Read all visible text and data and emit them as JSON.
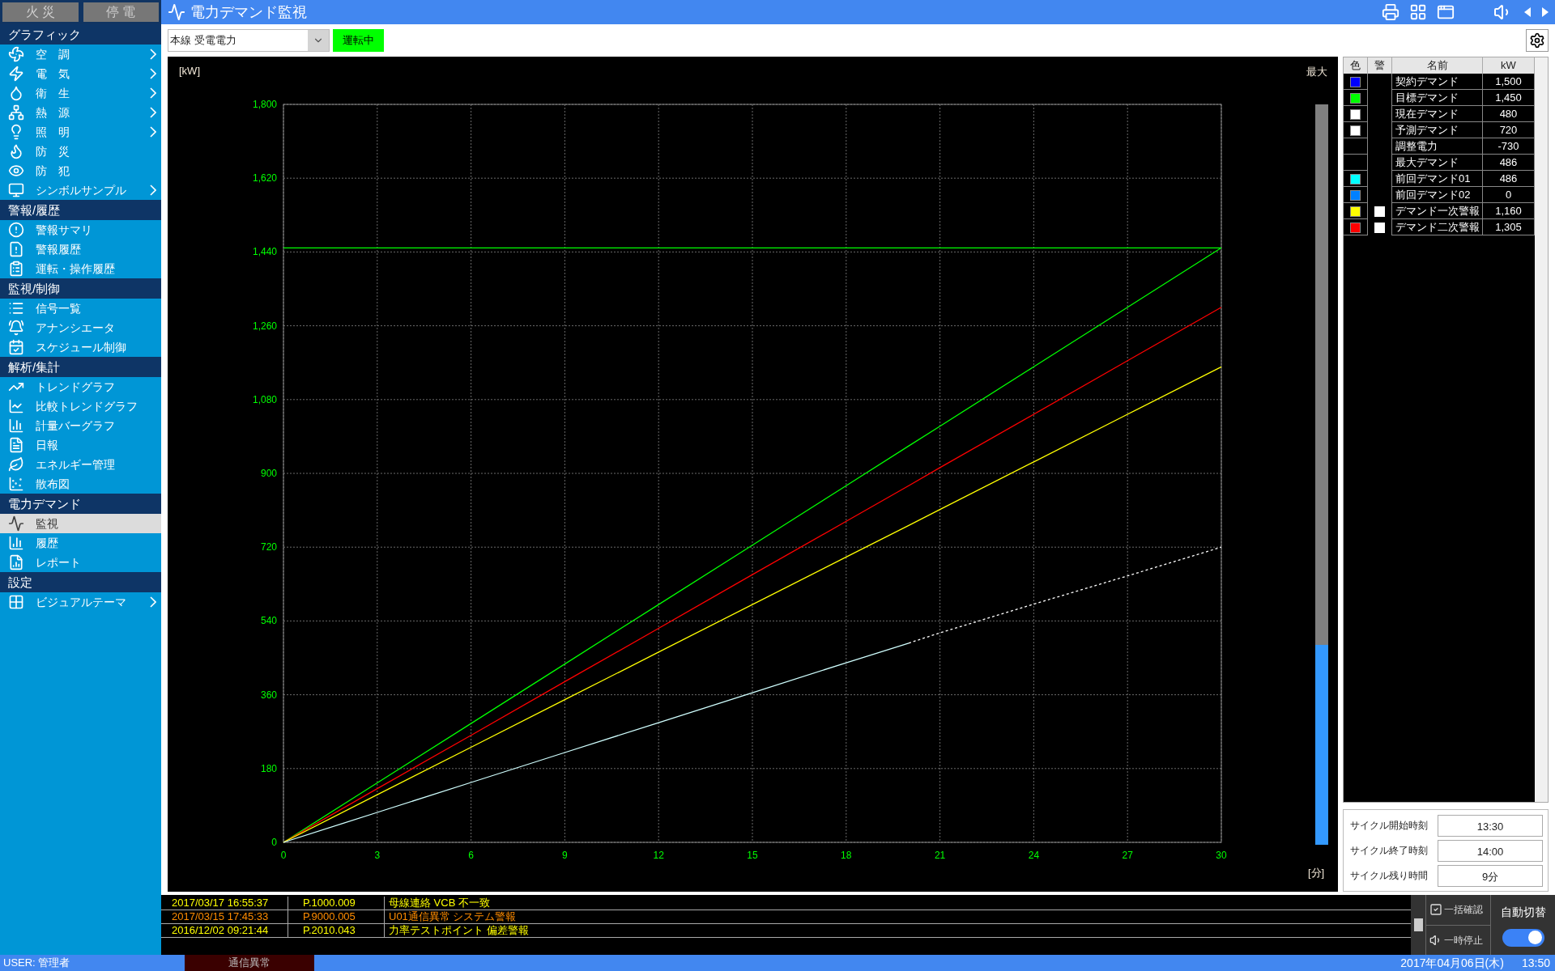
{
  "alarm_buttons": [
    "火 災",
    "停 電"
  ],
  "header": {
    "title": "電力デマンド監視"
  },
  "sidebar": {
    "sections": [
      {
        "title": "グラフィック",
        "items": [
          {
            "label": "空　調",
            "expandable": true,
            "selected": false
          },
          {
            "label": "電　気",
            "expandable": true,
            "selected": false
          },
          {
            "label": "衛　生",
            "expandable": true,
            "selected": false
          },
          {
            "label": "熱　源",
            "expandable": true,
            "selected": false
          },
          {
            "label": "照　明",
            "expandable": true,
            "selected": false
          },
          {
            "label": "防　災",
            "expandable": false,
            "selected": false
          },
          {
            "label": "防　犯",
            "expandable": false,
            "selected": false
          },
          {
            "label": "シンボルサンプル",
            "expandable": true,
            "selected": false
          }
        ]
      },
      {
        "title": "警報/履歴",
        "items": [
          {
            "label": "警報サマリ",
            "expandable": false,
            "selected": false
          },
          {
            "label": "警報履歴",
            "expandable": false,
            "selected": false
          },
          {
            "label": "運転・操作履歴",
            "expandable": false,
            "selected": false
          }
        ]
      },
      {
        "title": "監視/制御",
        "items": [
          {
            "label": "信号一覧",
            "expandable": false,
            "selected": false
          },
          {
            "label": "アナンシエータ",
            "expandable": false,
            "selected": false
          },
          {
            "label": "スケジュール制御",
            "expandable": false,
            "selected": false
          }
        ]
      },
      {
        "title": "解析/集計",
        "items": [
          {
            "label": "トレンドグラフ",
            "expandable": false,
            "selected": false
          },
          {
            "label": "比較トレンドグラフ",
            "expandable": false,
            "selected": false
          },
          {
            "label": "計量バーグラフ",
            "expandable": false,
            "selected": false
          },
          {
            "label": "日報",
            "expandable": false,
            "selected": false
          },
          {
            "label": "エネルギー管理",
            "expandable": false,
            "selected": false
          },
          {
            "label": "散布図",
            "expandable": false,
            "selected": false
          }
        ]
      },
      {
        "title": "電力デマンド",
        "items": [
          {
            "label": "監視",
            "expandable": false,
            "selected": true
          },
          {
            "label": "履歴",
            "expandable": false,
            "selected": false
          },
          {
            "label": "レポート",
            "expandable": false,
            "selected": false
          }
        ]
      },
      {
        "title": "設定",
        "items": [
          {
            "label": "ビジュアルテーマ",
            "expandable": true,
            "selected": false
          }
        ]
      }
    ]
  },
  "toolbar": {
    "source": "本線 受電電力",
    "status": "運転中"
  },
  "chart": {
    "unit_label": "[kW]",
    "x_unit_label": "[分]",
    "gauge_label": "最大",
    "gauge": {
      "level": 0.27
    },
    "chart_data": {
      "type": "line",
      "x": [
        0,
        3,
        6,
        9,
        12,
        15,
        18,
        20,
        21,
        24,
        27,
        30
      ],
      "ylim": [
        0,
        1800
      ],
      "xlim": [
        0,
        30
      ],
      "yticks": [
        {
          "value": 0,
          "label": "0"
        },
        {
          "value": 180,
          "label": "180"
        },
        {
          "value": 360,
          "label": "360"
        },
        {
          "value": 540,
          "label": "540"
        },
        {
          "value": 720,
          "label": "720"
        },
        {
          "value": 900,
          "label": "900"
        },
        {
          "value": 1080,
          "label": "1,080"
        },
        {
          "value": 1260,
          "label": "1,260"
        },
        {
          "value": 1440,
          "label": "1,440"
        },
        {
          "value": 1620,
          "label": "1,620"
        },
        {
          "value": 1800,
          "label": "1,800"
        }
      ],
      "xticks": [
        0,
        3,
        6,
        9,
        12,
        15,
        18,
        21,
        24,
        27,
        30
      ],
      "grid": true,
      "series": [
        {
          "color": "#00ff00",
          "line_style": "solid",
          "values": [
            1450,
            1450,
            1450,
            1450,
            1450,
            1450,
            1450,
            1450,
            1450,
            1450,
            1450,
            1450
          ]
        },
        {
          "color": "#00ff00",
          "line_style": "solid",
          "values": [
            0,
            145,
            290,
            435,
            580,
            725,
            870,
            967,
            1015,
            1160,
            1305,
            1450
          ]
        },
        {
          "color": "#ff0000",
          "line_style": "solid",
          "values": [
            0,
            131,
            261,
            392,
            522,
            653,
            783,
            870,
            914,
            1044,
            1175,
            1305
          ]
        },
        {
          "color": "#ffff00",
          "line_style": "solid",
          "values": [
            0,
            116,
            232,
            348,
            464,
            580,
            696,
            773,
            812,
            928,
            1044,
            1160
          ]
        },
        {
          "color": "#d0ffff",
          "line_style": "solid",
          "values": [
            0,
            73,
            146,
            219,
            292,
            365,
            438,
            486,
            null,
            null,
            null,
            null
          ]
        },
        {
          "color": "#ffffff",
          "line_style": "dashed",
          "values": [
            null,
            null,
            null,
            null,
            null,
            null,
            null,
            486,
            511,
            581,
            650,
            720
          ]
        }
      ]
    }
  },
  "legend": {
    "columns": [
      "色",
      "警",
      "名前",
      "kW"
    ],
    "rows": [
      {
        "color": "#0000ff",
        "alarm": false,
        "name": "契約デマンド",
        "value": "1,500"
      },
      {
        "color": "#00ff00",
        "alarm": false,
        "name": "目標デマンド",
        "value": "1,450"
      },
      {
        "color": "#ffffff",
        "alarm": false,
        "name": "現在デマンド",
        "value": "480"
      },
      {
        "color": "#ffffff",
        "alarm": false,
        "name": "予測デマンド",
        "value": "720"
      },
      {
        "alarm": false,
        "name": "調整電力",
        "value": "-730"
      },
      {
        "alarm": false,
        "name": "最大デマンド",
        "value": "486"
      },
      {
        "color": "#00ffff",
        "alarm": false,
        "name": "前回デマンド01",
        "value": "486"
      },
      {
        "color": "#0080ff",
        "alarm": false,
        "name": "前回デマンド02",
        "value": "0"
      },
      {
        "color": "#ffff00",
        "alarm": true,
        "name": "デマンド一次警報",
        "value": "1,160"
      },
      {
        "color": "#ff0000",
        "alarm": true,
        "name": "デマンド二次警報",
        "value": "1,305"
      }
    ]
  },
  "cycle": [
    {
      "label": "サイクル開始時刻",
      "value": "13:30"
    },
    {
      "label": "サイクル終了時刻",
      "value": "14:00"
    },
    {
      "label": "サイクル残り時間",
      "value": "9分"
    }
  ],
  "alarm_log": [
    {
      "time": "2017/03/17 16:55:37",
      "point": "P.1000.009",
      "message": "母線連絡 VCB 不一致",
      "color": "#ffff00"
    },
    {
      "time": "2017/03/15 17:45:33",
      "point": "P.9000.005",
      "message": "U01通信異常 システム警報",
      "color": "#ff8c00"
    },
    {
      "time": "2016/12/02 09:21:44",
      "point": "P.2010.043",
      "message": "力率テストポイント 偏差警報",
      "color": "#ffff00"
    }
  ],
  "log_buttons": [
    "一括確認",
    "一時停止"
  ],
  "auto_switch": {
    "label": "自動切替",
    "on": true
  },
  "status_bar": {
    "user": "USER: 管理者",
    "comm": "通信異常",
    "date": "2017年04月06日(木)",
    "time": "13:50"
  }
}
